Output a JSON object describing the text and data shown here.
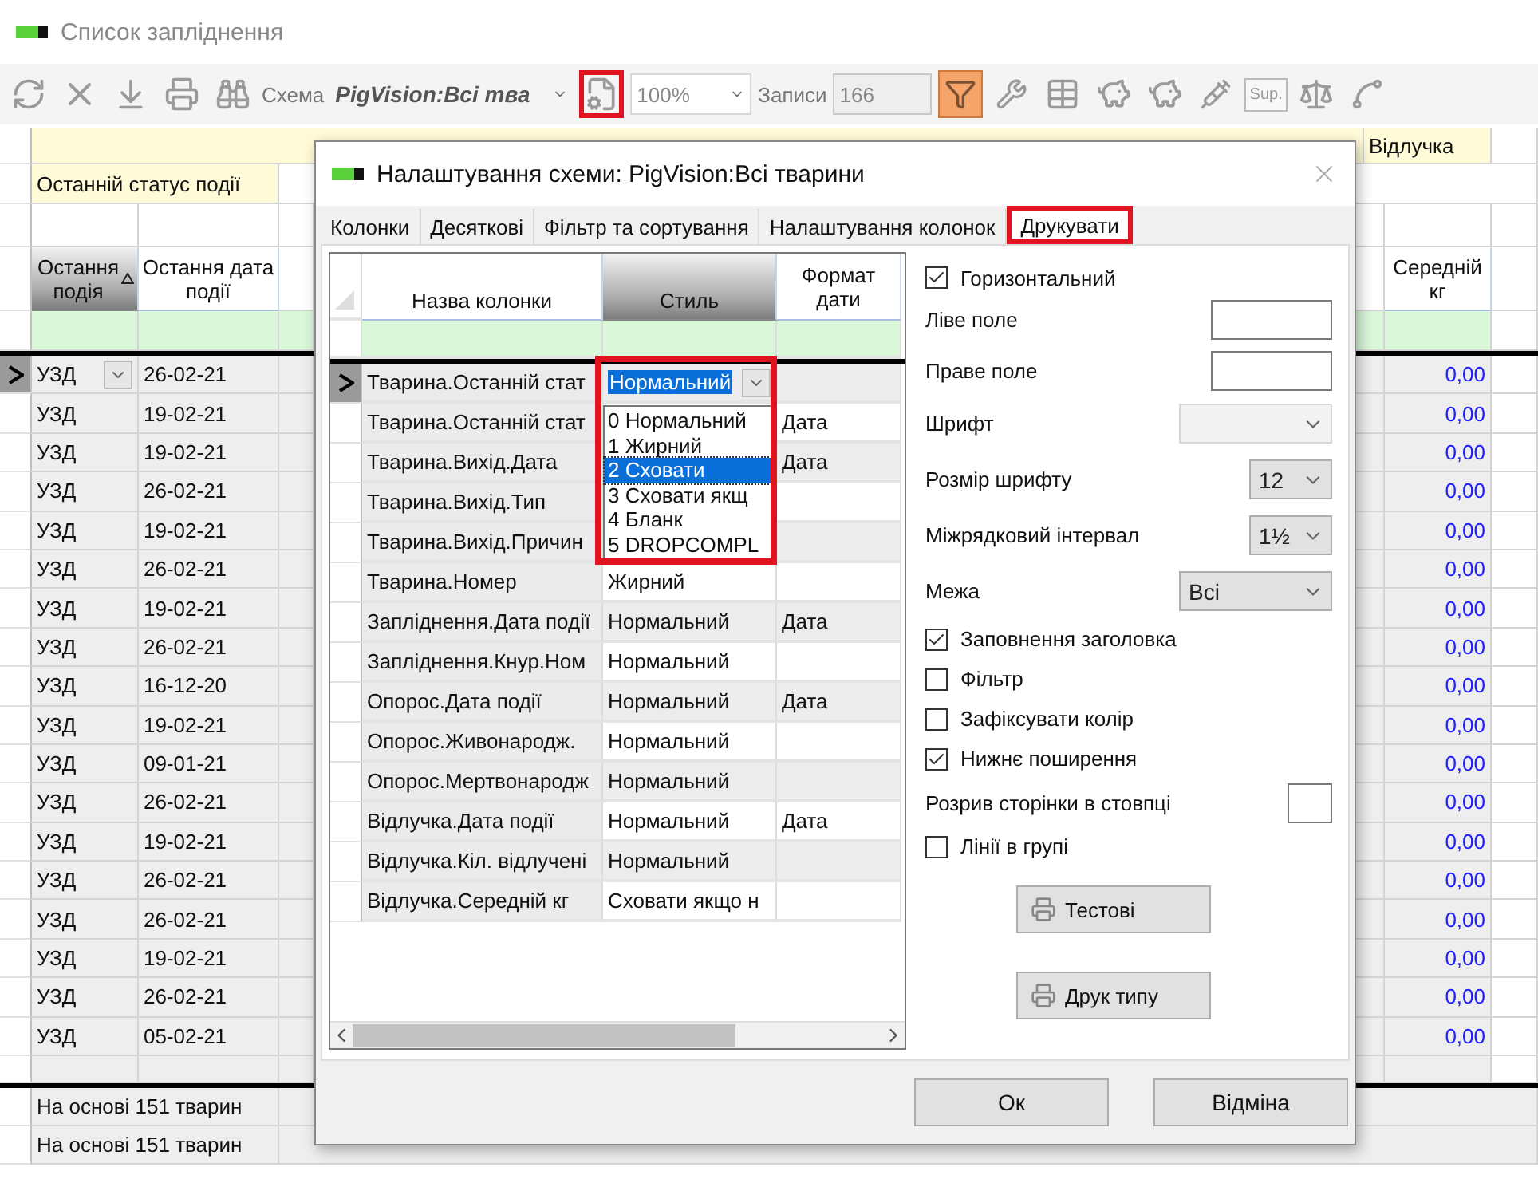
{
  "window": {
    "title": "Список запліднення"
  },
  "toolbar": {
    "schema_label": "Схема",
    "schema_value": "PigVision:Всі тва",
    "settings_highlighted": true,
    "zoom_value": "100%",
    "records_label": "Записи",
    "records_value": "166",
    "filter_active": true,
    "sup_label": "Sup."
  },
  "grid": {
    "group_header": "Відлучка",
    "status_header": "Останній статус події",
    "columns": [
      {
        "label": "Остання подія",
        "sorted": true
      },
      {
        "label": "Остання дата події",
        "sorted": false
      },
      {
        "label": "Середній кг",
        "sorted": false
      }
    ],
    "rows": [
      {
        "event": "УЗД",
        "date": "26-02-21",
        "avg": "0,00",
        "selected": true
      },
      {
        "event": "УЗД",
        "date": "19-02-21",
        "avg": "0,00",
        "selected": false
      },
      {
        "event": "УЗД",
        "date": "19-02-21",
        "avg": "0,00",
        "selected": false
      },
      {
        "event": "УЗД",
        "date": "26-02-21",
        "avg": "0,00",
        "selected": false
      },
      {
        "event": "УЗД",
        "date": "19-02-21",
        "avg": "0,00",
        "selected": false
      },
      {
        "event": "УЗД",
        "date": "26-02-21",
        "avg": "0,00",
        "selected": false
      },
      {
        "event": "УЗД",
        "date": "19-02-21",
        "avg": "0,00",
        "selected": false
      },
      {
        "event": "УЗД",
        "date": "26-02-21",
        "avg": "0,00",
        "selected": false
      },
      {
        "event": "УЗД",
        "date": "16-12-20",
        "avg": "0,00",
        "selected": false
      },
      {
        "event": "УЗД",
        "date": "19-02-21",
        "avg": "0,00",
        "selected": false
      },
      {
        "event": "УЗД",
        "date": "09-01-21",
        "avg": "0,00",
        "selected": false
      },
      {
        "event": "УЗД",
        "date": "26-02-21",
        "avg": "0,00",
        "selected": false
      },
      {
        "event": "УЗД",
        "date": "19-02-21",
        "avg": "0,00",
        "selected": false
      },
      {
        "event": "УЗД",
        "date": "26-02-21",
        "avg": "0,00",
        "selected": false
      },
      {
        "event": "УЗД",
        "date": "26-02-21",
        "avg": "0,00",
        "selected": false
      },
      {
        "event": "УЗД",
        "date": "19-02-21",
        "avg": "0,00",
        "selected": false
      },
      {
        "event": "УЗД",
        "date": "26-02-21",
        "avg": "0,00",
        "selected": false
      },
      {
        "event": "УЗД",
        "date": "05-02-21",
        "avg": "0,00",
        "selected": false
      }
    ],
    "footer": [
      "На основі 151 тварин",
      "На основі 151 тварин"
    ]
  },
  "dialog": {
    "title": "Налаштування схеми: PigVision:Всі тварини",
    "tabs": [
      {
        "label": "Колонки",
        "selected": false
      },
      {
        "label": "Десяткові",
        "selected": false
      },
      {
        "label": "Фільтр та сортування",
        "selected": false
      },
      {
        "label": "Налаштування колонок",
        "selected": false
      },
      {
        "label": "Друкувати",
        "selected": true
      }
    ],
    "columns": [
      "Назва колонки",
      "Стиль",
      "Формат дати"
    ],
    "rows": [
      {
        "name": "Тварина.Останній стат",
        "style": "Нормальний",
        "editing": true
      },
      {
        "name": "Тварина.Останній стат",
        "format": "Дата",
        "editing": false
      },
      {
        "name": "Тварина.Вихід.Дата",
        "format": "Дата",
        "editing": false
      },
      {
        "name": "Тварина.Вихід.Тип",
        "editing": false
      },
      {
        "name": "Тварина.Вихід.Причин",
        "editing": false
      },
      {
        "name": "Тварина.Номер",
        "style": "Жирний",
        "editing": false
      },
      {
        "name": "Запліднення.Дата події",
        "style": "Нормальний",
        "format": "Дата",
        "editing": false
      },
      {
        "name": "Запліднення.Кнур.Ном",
        "style": "Нормальний",
        "editing": false
      },
      {
        "name": "Опорос.Дата події",
        "style": "Нормальний",
        "format": "Дата",
        "editing": false
      },
      {
        "name": "Опорос.Живонародж.",
        "style": "Нормальний",
        "editing": false
      },
      {
        "name": "Опорос.Мертвонародж",
        "style": "Нормальний",
        "editing": false
      },
      {
        "name": "Відлучка.Дата події",
        "style": "Нормальний",
        "format": "Дата",
        "editing": false
      },
      {
        "name": "Відлучка.Кіл. відлучені",
        "style": "Нормальний",
        "editing": false
      },
      {
        "name": "Відлучка.Середній кг",
        "style": "Сховати якщо н",
        "editing": false
      }
    ],
    "style_options": [
      {
        "label": "0 Нормальний",
        "selected": false
      },
      {
        "label": "1 Жирний",
        "selected": false
      },
      {
        "label": "2 Сховати",
        "selected": true
      },
      {
        "label": "3 Сховати якщ",
        "selected": false
      },
      {
        "label": "4 Бланк",
        "selected": false
      },
      {
        "label": "5 DROPCOMPL",
        "selected": false
      }
    ],
    "settings": [
      {
        "kind": "checkbox",
        "label": "Горизонтальний",
        "checked": true
      },
      {
        "kind": "field",
        "label": "Ліве поле"
      },
      {
        "kind": "field",
        "label": "Праве поле"
      },
      {
        "kind": "combo",
        "label": "Шрифт",
        "disabled": true
      },
      {
        "kind": "combo",
        "label": "Розмір шрифту",
        "value": "12",
        "disabled": false
      },
      {
        "kind": "combo",
        "label": "Міжрядковий інтервал",
        "value": "1½",
        "disabled": false
      },
      {
        "kind": "combo",
        "label": "Межа",
        "value": "Всі",
        "disabled": false
      },
      {
        "kind": "checkbox",
        "label": "Заповнення заголовка",
        "checked": true
      },
      {
        "kind": "checkbox",
        "label": "Фільтр",
        "checked": false
      },
      {
        "kind": "checkbox",
        "label": "Зафіксувати колір",
        "checked": false
      },
      {
        "kind": "checkbox",
        "label": "Нижнє поширення",
        "checked": true
      },
      {
        "kind": "box",
        "label": "Розрив сторінки в стовпці"
      },
      {
        "kind": "checkbox",
        "label": "Лінії в групі",
        "checked": false
      }
    ],
    "print_buttons": [
      "Тестові",
      "Друк типу"
    ],
    "buttons": [
      "Ок",
      "Відміна"
    ]
  }
}
